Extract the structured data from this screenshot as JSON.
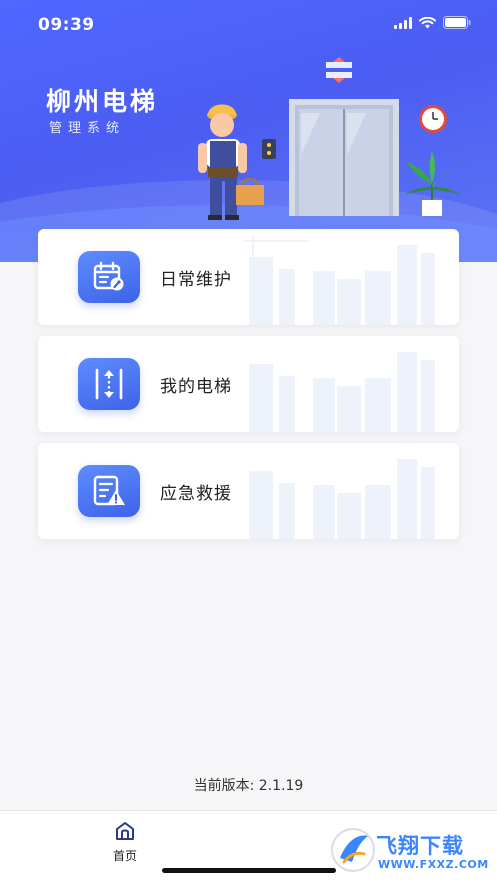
{
  "status": {
    "time": "09:39"
  },
  "header": {
    "title": "柳州电梯",
    "subtitle": "管理系统"
  },
  "menu": [
    {
      "label": "日常维护",
      "icon": "calendar-wrench-icon"
    },
    {
      "label": "我的电梯",
      "icon": "elevator-icon"
    },
    {
      "label": "应急救援",
      "icon": "emergency-document-icon"
    }
  ],
  "version": "当前版本: 2.1.19",
  "tabbar": {
    "home_label": "首页"
  },
  "watermark": {
    "brand": "飞翔下载",
    "site": "WWW.FXXZ.COM"
  },
  "colors": {
    "accent": "#4b5df2",
    "icon_bg": "#3d63e8",
    "card_bg": "#ffffff",
    "page_bg": "#f6f6f8"
  }
}
